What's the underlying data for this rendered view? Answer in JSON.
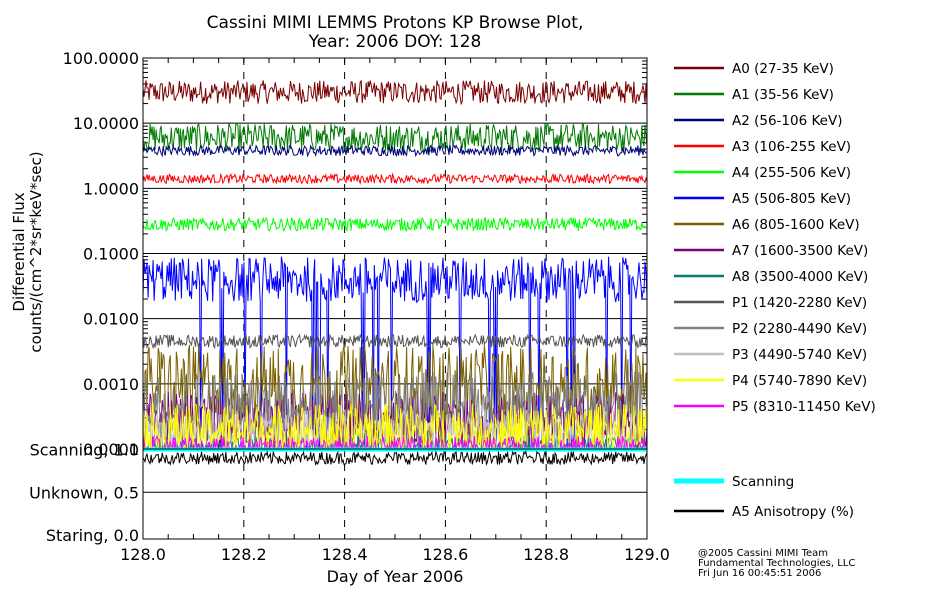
{
  "chart_data": {
    "type": "line",
    "title_line1": "Cassini MIMI LEMMS Protons KP Browse Plot,",
    "title_line2": "Year: 2006 DOY: 128",
    "ylabel_line1": "Differential Flux",
    "ylabel_line2": "counts/(cm^2*sr*keV*sec)",
    "xlabel": "Day of Year 2006",
    "x_range": [
      128.0,
      129.0
    ],
    "x_ticks": [
      "128.0",
      "128.2",
      "128.4",
      "128.6",
      "128.8",
      "129.0"
    ],
    "y_scale": "log",
    "y_range": [
      0.0001,
      100
    ],
    "y_ticks": [
      "0.0001",
      "0.0010",
      "0.0100",
      "0.1000",
      "1.0000",
      "10.0000",
      "100.0000"
    ],
    "grid": "dashed vertical at x ticks, solid horizontal at y decades",
    "series": [
      {
        "name": "A0 (27-35 KeV)",
        "color": "#7a0000",
        "typical": 30,
        "spread": 0.18
      },
      {
        "name": "A1 (35-56 KeV)",
        "color": "#007a00",
        "typical": 6,
        "spread": 0.22
      },
      {
        "name": "A2 (56-106 KeV)",
        "color": "#00007a",
        "typical": 3.8,
        "spread": 0.08
      },
      {
        "name": "A3 (106-255 KeV)",
        "color": "#ff0000",
        "typical": 1.4,
        "spread": 0.07
      },
      {
        "name": "A4 (255-506 KeV)",
        "color": "#00ff00",
        "typical": 0.28,
        "spread": 0.1
      },
      {
        "name": "A5 (506-805 KeV)",
        "color": "#0000ff",
        "typical": 0.04,
        "spread": 0.35
      },
      {
        "name": "A6 (805-1600 KeV)",
        "color": "#7a6000",
        "typical": 0.001,
        "spread": 0.6
      },
      {
        "name": "A7 (1600-3500 KeV)",
        "color": "#7a007a",
        "typical": 0.0003,
        "spread": 0.4
      },
      {
        "name": "A8 (3500-4000 KeV)",
        "color": "#007a7a",
        "typical": 0.00012,
        "spread": 0.1
      },
      {
        "name": "P1 (1420-2280 KeV)",
        "color": "#555555",
        "typical": 0.0045,
        "spread": 0.1
      },
      {
        "name": "P2 (2280-4490 KeV)",
        "color": "#808080",
        "typical": 0.0005,
        "spread": 0.5
      },
      {
        "name": "P3 (4490-5740 KeV)",
        "color": "#c0c0c0",
        "typical": 0.0002,
        "spread": 0.3
      },
      {
        "name": "P4 (5740-7890 KeV)",
        "color": "#ffff00",
        "typical": 0.0002,
        "spread": 0.4
      },
      {
        "name": "P5 (8310-11450 KeV)",
        "color": "#ff00ff",
        "typical": 0.0001,
        "spread": 0.2
      }
    ],
    "lower_panel": {
      "y_ticks": [
        "Scanning, 1.0",
        "Unknown, 0.5",
        "Staring, 0.0"
      ],
      "series": [
        {
          "name": "Scanning",
          "color": "#00ffff",
          "value": 1.0
        },
        {
          "name": "A5 Anisotropy (%)",
          "color": "#000000",
          "typical": 0.9
        }
      ]
    }
  },
  "credits": {
    "line1": "@2005 Cassini MIMI Team",
    "line2": "Fundamental Technologies, LLC",
    "line3": "Fri Jun 16 00:45:51 2006"
  }
}
